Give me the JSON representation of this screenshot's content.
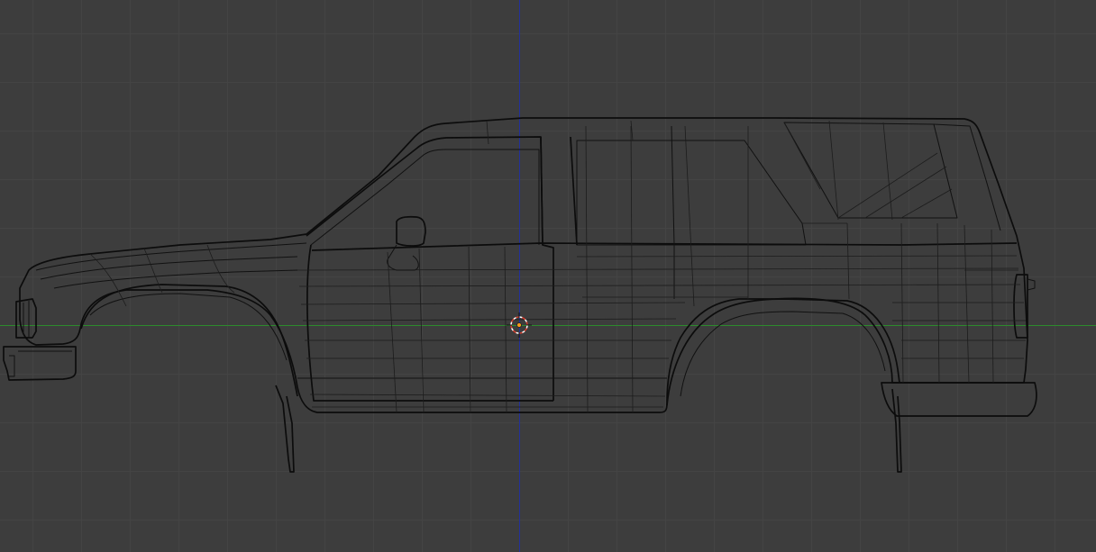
{
  "viewport": {
    "background": "#3d3d3d",
    "grid_color": "#444444",
    "x_axis_color": "#2c8a2c",
    "z_axis_color": "#23309a"
  },
  "scene": {
    "object": "suv-body-wireframe",
    "display_mode": "wireframe",
    "view": "side",
    "wire_color": "#111111"
  },
  "cursor": {
    "icon": "3d-cursor-icon",
    "ring_colors": [
      "#d23b2b",
      "#ffffff"
    ]
  },
  "origin": {
    "icon": "object-origin-icon",
    "color": "#ff9a1a"
  }
}
